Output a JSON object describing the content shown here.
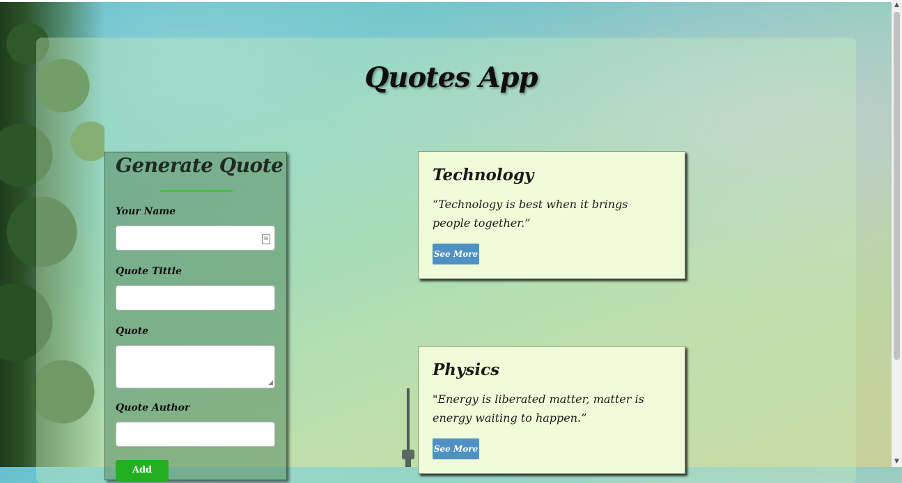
{
  "app": {
    "title": "Quotes App"
  },
  "form": {
    "title": "Generate Quote",
    "fields": [
      {
        "label": "Your Name",
        "value": "",
        "placeholder": ""
      },
      {
        "label": "Quote Tittle",
        "value": "",
        "placeholder": ""
      },
      {
        "label": "Quote",
        "value": "",
        "placeholder": ""
      },
      {
        "label": "Quote Author",
        "value": "",
        "placeholder": ""
      }
    ],
    "submit_label": "Add"
  },
  "quotes": [
    {
      "title": "Technology",
      "text": "“Technology is best when it brings people together.”",
      "button_label": "See More"
    },
    {
      "title": "Physics",
      "text": "\"Energy is liberated matter, matter is energy waiting to happen.”",
      "button_label": "See More"
    }
  ],
  "colors": {
    "panel_overlay": "#c8f0be",
    "card_background": "#f0fcd9",
    "see_more_button": "#4e91c2",
    "submit_button": "#22b022",
    "underline_accent": "#3fc23f"
  },
  "icons": [
    "contact-card-icon",
    "textarea-resize-icon",
    "scroll-up-arrow-icon",
    "scroll-down-arrow-icon"
  ]
}
